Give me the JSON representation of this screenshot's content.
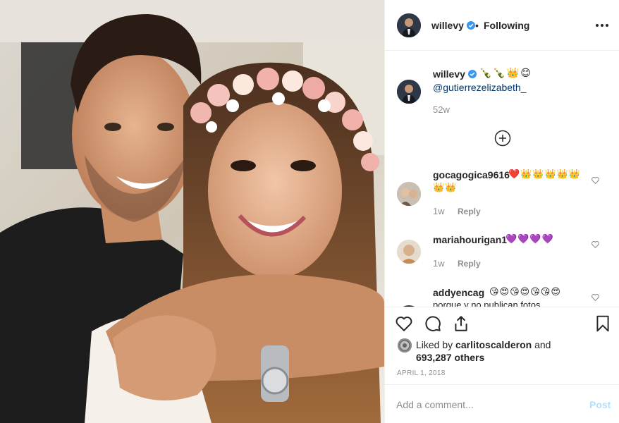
{
  "post": {
    "image_description_icon": "photo-couple-flower-crown"
  },
  "header": {
    "username": "willevy",
    "verified": true,
    "separator": "•",
    "follow_status": "Following",
    "more_icon": "more-options-icon"
  },
  "caption": {
    "username": "willevy",
    "emoji": "🍾🍾👑😊",
    "mention": "@gutierrezelizabeth_",
    "time": "52w"
  },
  "load_more_icon": "plus-circle-icon",
  "comments": [
    {
      "username": "gocagogica9616",
      "text_inline": "❤️👑👑👑👑👑",
      "text_line2": "👑👑",
      "time": "1w",
      "reply": "Reply"
    },
    {
      "username": "mariahourigan1",
      "text_inline": "💜💜💜💜",
      "time": "1w",
      "reply": "Reply"
    },
    {
      "username": "addyencag",
      "text_inline": "😘😍😘😍😘😘😍",
      "text_line2": "porque y no publican fotos"
    }
  ],
  "likes": {
    "prefix": "Liked by",
    "liker": "carlitoscalderon",
    "and": "and",
    "count": "693,287 others"
  },
  "date": "APRIL 1, 2018",
  "add_comment": {
    "placeholder": "Add a comment...",
    "post_label": "Post"
  },
  "colors": {
    "verified": "#3897f0",
    "link": "#003569",
    "muted": "#8e8e8e",
    "post_disabled": "#b2dffc"
  }
}
